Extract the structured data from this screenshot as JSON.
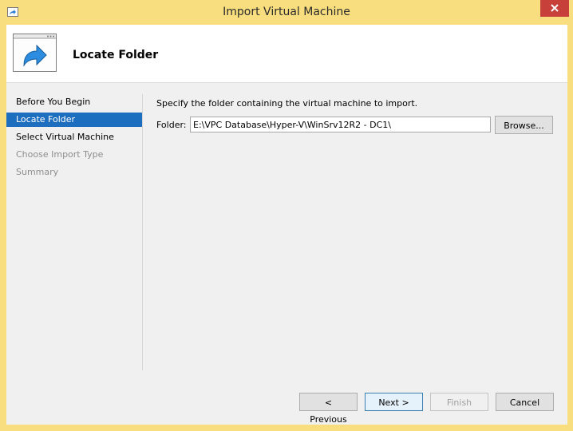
{
  "window": {
    "title": "Import Virtual Machine",
    "icon": "arrow-right-icon"
  },
  "header": {
    "title": "Locate Folder",
    "icon": "import-arrow-icon"
  },
  "nav": {
    "items": [
      {
        "label": "Before You Begin",
        "state": "normal"
      },
      {
        "label": "Locate Folder",
        "state": "selected"
      },
      {
        "label": "Select Virtual Machine",
        "state": "normal"
      },
      {
        "label": "Choose Import Type",
        "state": "disabled"
      },
      {
        "label": "Summary",
        "state": "disabled"
      }
    ]
  },
  "content": {
    "instruction": "Specify the folder containing the virtual machine to import.",
    "folder_label": "Folder:",
    "folder_value": "E:\\VPC Database\\Hyper-V\\WinSrv12R2 - DC1\\",
    "browse_label": "Browse..."
  },
  "footer": {
    "previous_label": "< Previous",
    "next_label": "Next >",
    "finish_label": "Finish",
    "cancel_label": "Cancel"
  },
  "colors": {
    "titlebar": "#f8de7e",
    "selection": "#1e6ebf",
    "close": "#c7403a"
  }
}
